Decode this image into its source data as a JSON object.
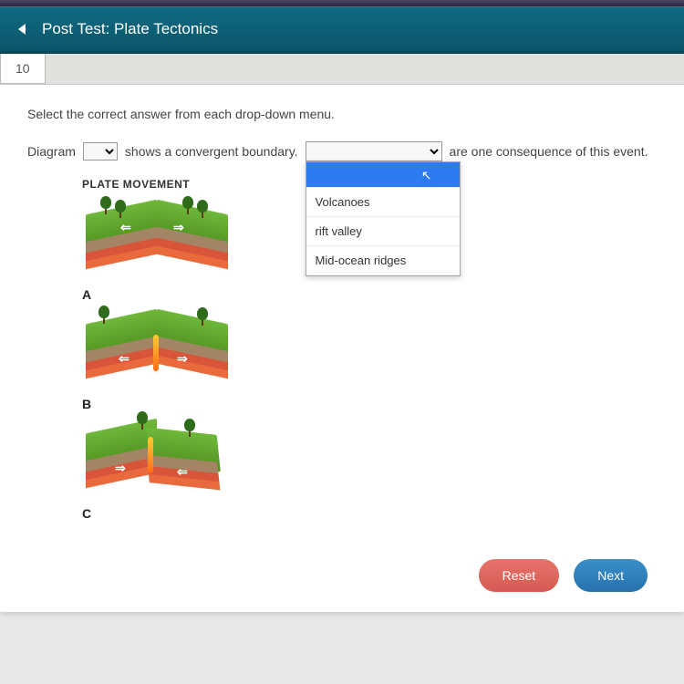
{
  "header": {
    "title": "Post Test: Plate Tectonics"
  },
  "question": {
    "number": "10",
    "instruction": "Select the correct answer from each drop-down menu.",
    "sentence_part1": "Diagram",
    "sentence_part2": "shows a convergent boundary.",
    "sentence_part3": "are one consequence of this event.",
    "plate_title": "PLATE MOVEMENT",
    "labels": {
      "a": "A",
      "b": "B",
      "c": "C"
    }
  },
  "dropdown2": {
    "blank": "",
    "options": [
      "Volcanoes",
      "rift valley",
      "Mid-ocean ridges"
    ]
  },
  "buttons": {
    "reset": "Reset",
    "next": "Next"
  }
}
